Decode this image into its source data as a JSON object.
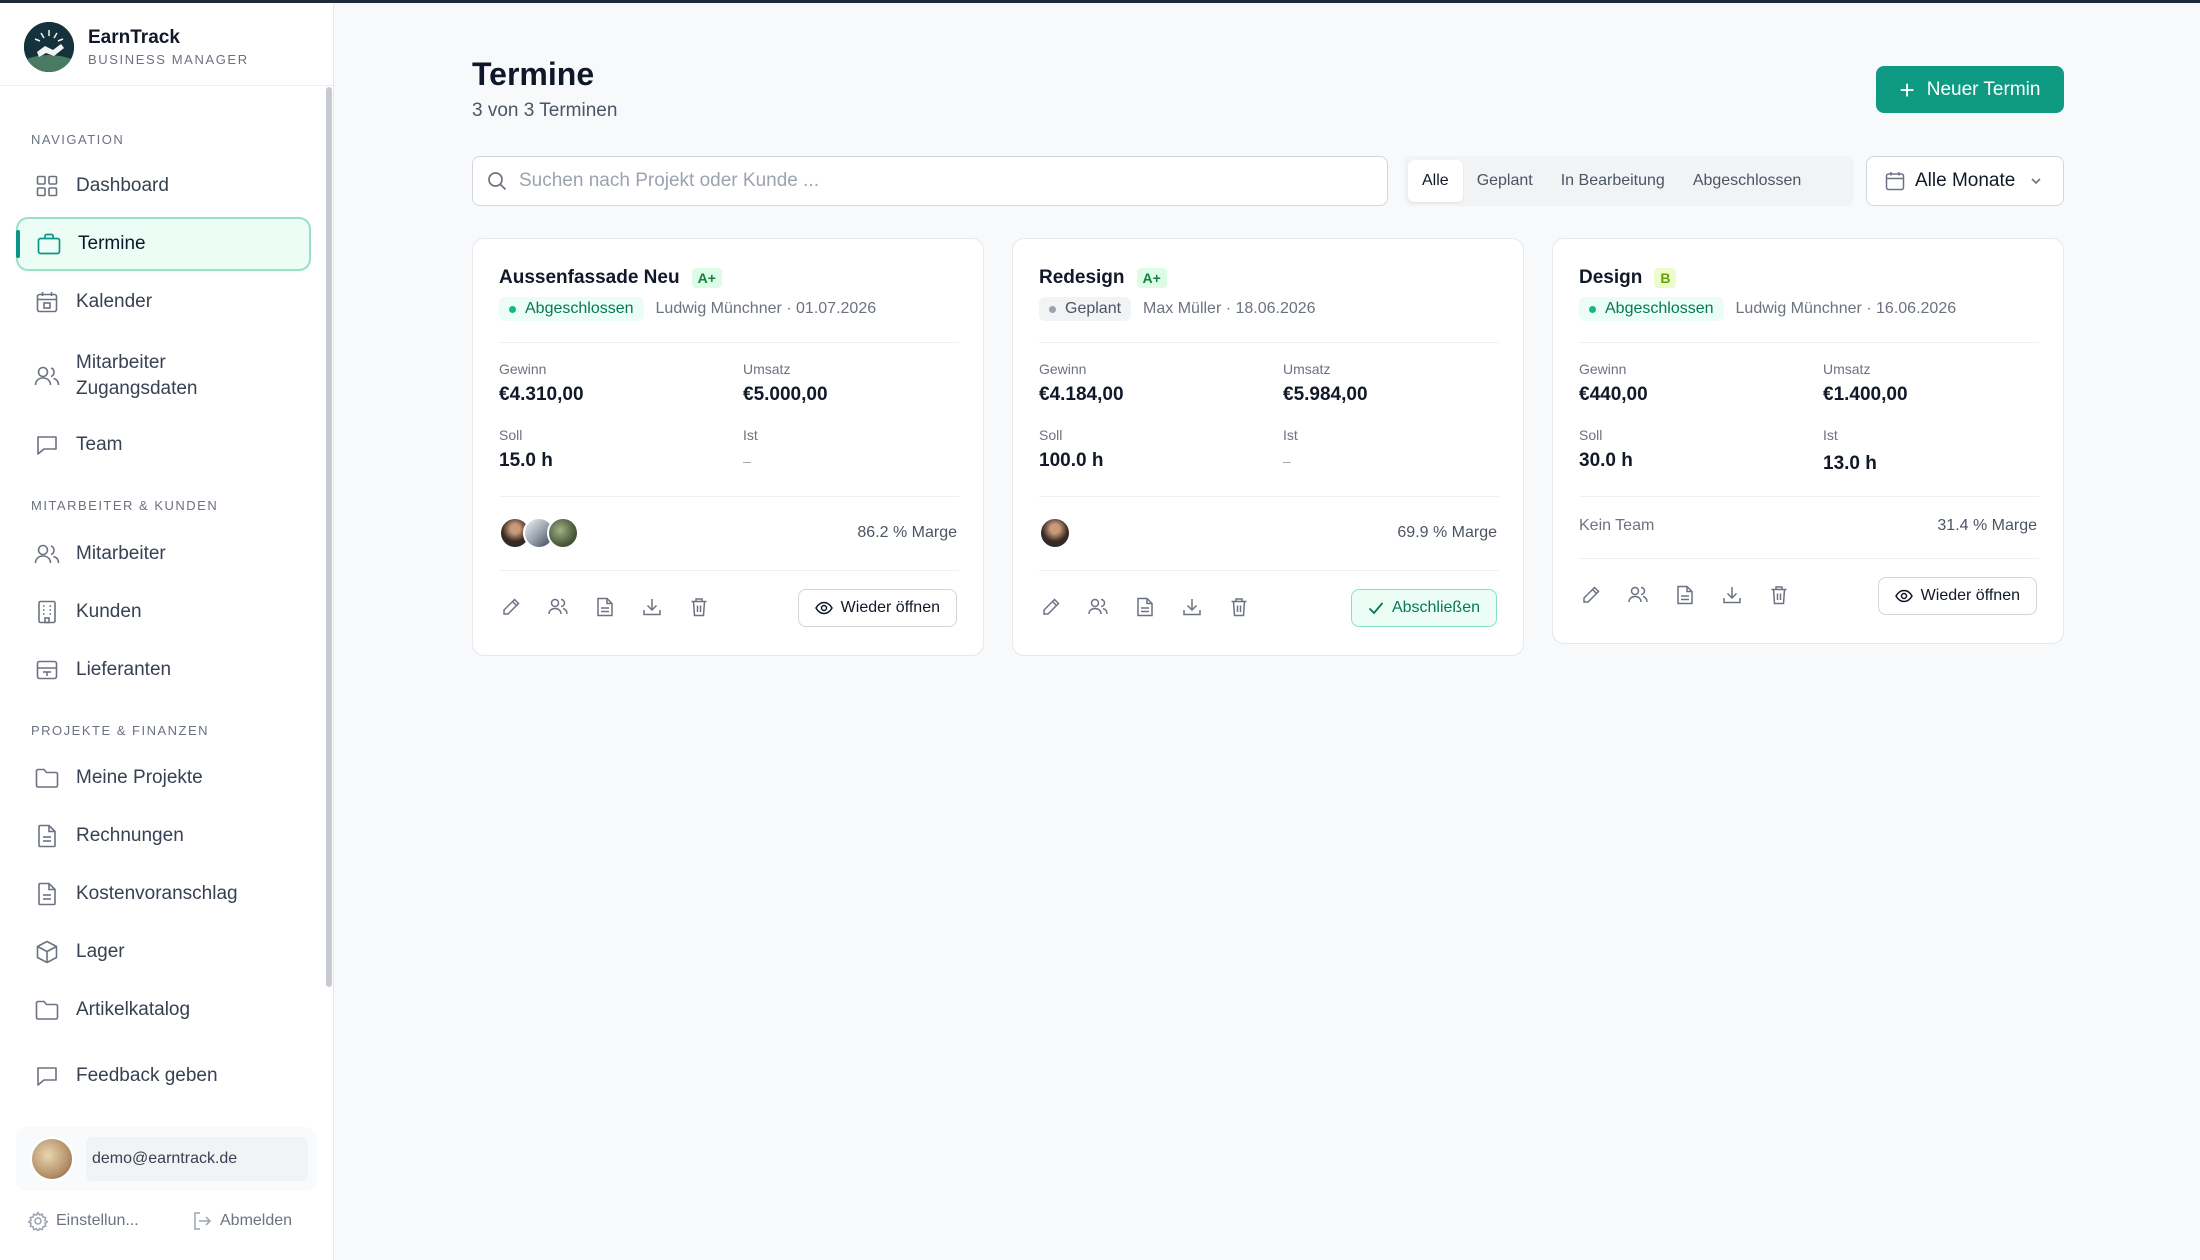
{
  "app": {
    "name": "EarnTrack",
    "subtitle": "BUSINESS MANAGER"
  },
  "sidebar": {
    "sections": [
      {
        "title": "NAVIGATION"
      },
      {
        "title": "MITARBEITER & KUNDEN"
      },
      {
        "title": "PROJEKTE & FINANZEN"
      }
    ],
    "items": [
      {
        "label": "Dashboard",
        "icon": "grid-icon"
      },
      {
        "label": "Termine",
        "icon": "briefcase-icon",
        "active": true
      },
      {
        "label": "Kalender",
        "icon": "calendar-icon"
      },
      {
        "label": "Mitarbeiter Zugangsdaten",
        "icon": "users-icon"
      },
      {
        "label": "Team",
        "icon": "chat-icon"
      },
      {
        "label": "Mitarbeiter",
        "icon": "users-icon"
      },
      {
        "label": "Kunden",
        "icon": "building-icon"
      },
      {
        "label": "Lieferanten",
        "icon": "truck-icon"
      },
      {
        "label": "Meine Projekte",
        "icon": "folder-icon"
      },
      {
        "label": "Rechnungen",
        "icon": "document-icon"
      },
      {
        "label": "Kostenvoranschlag",
        "icon": "document-icon"
      },
      {
        "label": "Lager",
        "icon": "box-icon"
      },
      {
        "label": "Artikelkatalog",
        "icon": "folder-icon"
      },
      {
        "label": "Feedback geben",
        "icon": "chat-icon"
      }
    ],
    "user_email": "demo@earntrack.de",
    "settings_label": "Einstellun...",
    "logout_label": "Abmelden"
  },
  "main": {
    "title": "Termine",
    "subtitle": "3 von 3 Terminen",
    "new_button": "Neuer Termin",
    "search_placeholder": "Suchen nach Projekt oder Kunde ...",
    "filters": [
      "Alle",
      "Geplant",
      "In Bearbeitung",
      "Abgeschlossen"
    ],
    "active_filter": "Alle",
    "month_select": "Alle Monate",
    "labels": {
      "gewinn": "Gewinn",
      "umsatz": "Umsatz",
      "soll": "Soll",
      "ist": "Ist"
    }
  },
  "cards": [
    {
      "title": "Aussenfassade Neu",
      "grade": "A+",
      "status": "Abgeschlossen",
      "meta": "Ludwig Münchner · 01.07.2026",
      "gewinn": "€4.310,00",
      "umsatz": "€5.000,00",
      "soll": "15.0 h",
      "ist": "–",
      "marge": "86.2 % Marge",
      "action": "Wieder öffnen"
    },
    {
      "title": "Redesign",
      "grade": "A+",
      "status": "Geplant",
      "meta": "Max Müller · 18.06.2026",
      "gewinn": "€4.184,00",
      "umsatz": "€5.984,00",
      "soll": "100.0 h",
      "ist": "–",
      "marge": "69.9 % Marge",
      "action": "Abschließen"
    },
    {
      "title": "Design",
      "grade": "B",
      "status": "Abgeschlossen",
      "meta": "Ludwig Münchner · 16.06.2026",
      "gewinn": "€440,00",
      "umsatz": "€1.400,00",
      "soll": "30.0 h",
      "ist": "13.0 h",
      "team_label": "Kein Team",
      "marge": "31.4 % Marge",
      "action": "Wieder öffnen"
    }
  ]
}
